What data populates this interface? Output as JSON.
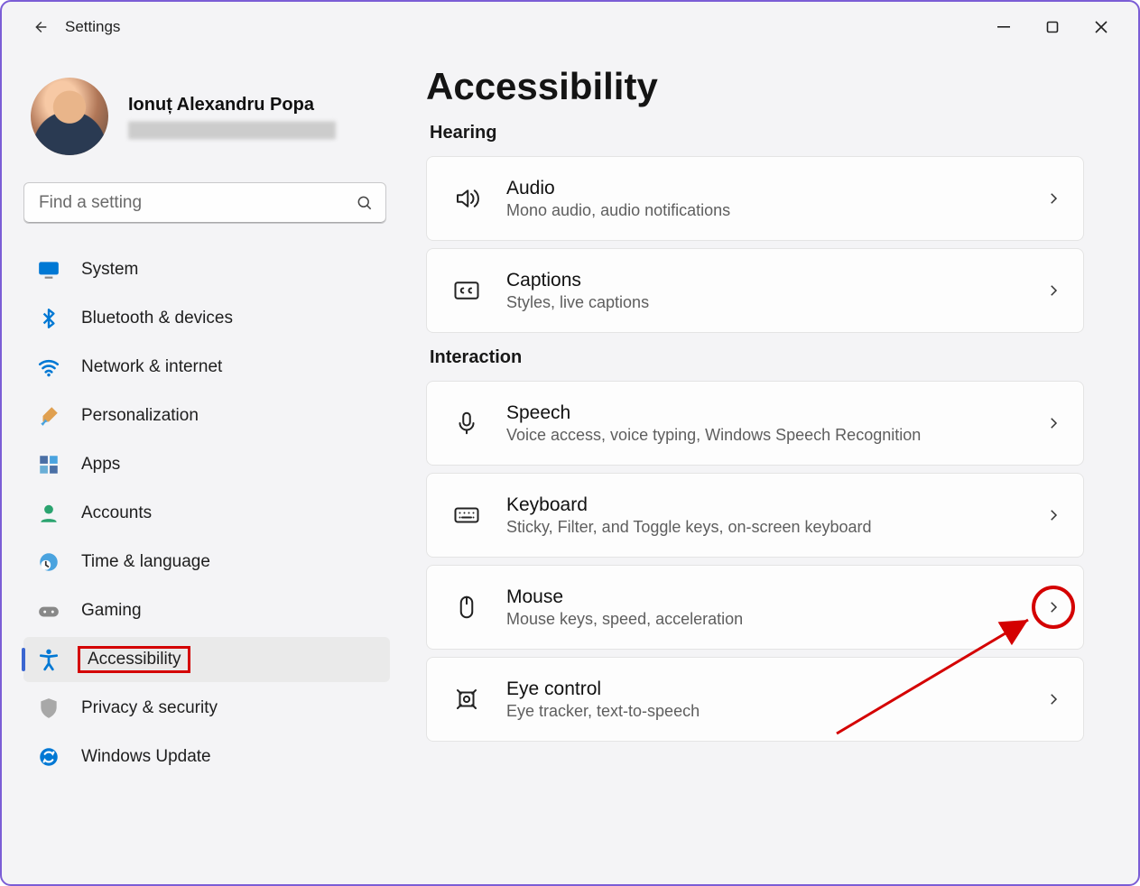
{
  "window": {
    "title": "Settings"
  },
  "profile": {
    "name": "Ionuț Alexandru Popa"
  },
  "search": {
    "placeholder": "Find a setting"
  },
  "nav": {
    "items": [
      {
        "key": "system",
        "label": "System",
        "icon": "monitor"
      },
      {
        "key": "bluetooth",
        "label": "Bluetooth & devices",
        "icon": "bluetooth"
      },
      {
        "key": "network",
        "label": "Network & internet",
        "icon": "wifi"
      },
      {
        "key": "personalization",
        "label": "Personalization",
        "icon": "brush"
      },
      {
        "key": "apps",
        "label": "Apps",
        "icon": "apps"
      },
      {
        "key": "accounts",
        "label": "Accounts",
        "icon": "person"
      },
      {
        "key": "time",
        "label": "Time & language",
        "icon": "clock-globe"
      },
      {
        "key": "gaming",
        "label": "Gaming",
        "icon": "gamepad"
      },
      {
        "key": "accessibility",
        "label": "Accessibility",
        "icon": "accessibility",
        "active": true,
        "highlight": true
      },
      {
        "key": "privacy",
        "label": "Privacy & security",
        "icon": "shield"
      },
      {
        "key": "update",
        "label": "Windows Update",
        "icon": "sync"
      }
    ]
  },
  "page": {
    "title": "Accessibility",
    "sections": [
      {
        "heading": "Hearing",
        "cards": [
          {
            "key": "audio",
            "title": "Audio",
            "sub": "Mono audio, audio notifications",
            "icon": "speaker"
          },
          {
            "key": "captions",
            "title": "Captions",
            "sub": "Styles, live captions",
            "icon": "cc"
          }
        ]
      },
      {
        "heading": "Interaction",
        "cards": [
          {
            "key": "speech",
            "title": "Speech",
            "sub": "Voice access, voice typing, Windows Speech Recognition",
            "icon": "mic"
          },
          {
            "key": "keyboard",
            "title": "Keyboard",
            "sub": "Sticky, Filter, and Toggle keys, on-screen keyboard",
            "icon": "keyboard"
          },
          {
            "key": "mouse",
            "title": "Mouse",
            "sub": "Mouse keys, speed, acceleration",
            "icon": "mouse",
            "annotate": true
          },
          {
            "key": "eye",
            "title": "Eye control",
            "sub": "Eye tracker, text-to-speech",
            "icon": "eye"
          }
        ]
      }
    ]
  }
}
